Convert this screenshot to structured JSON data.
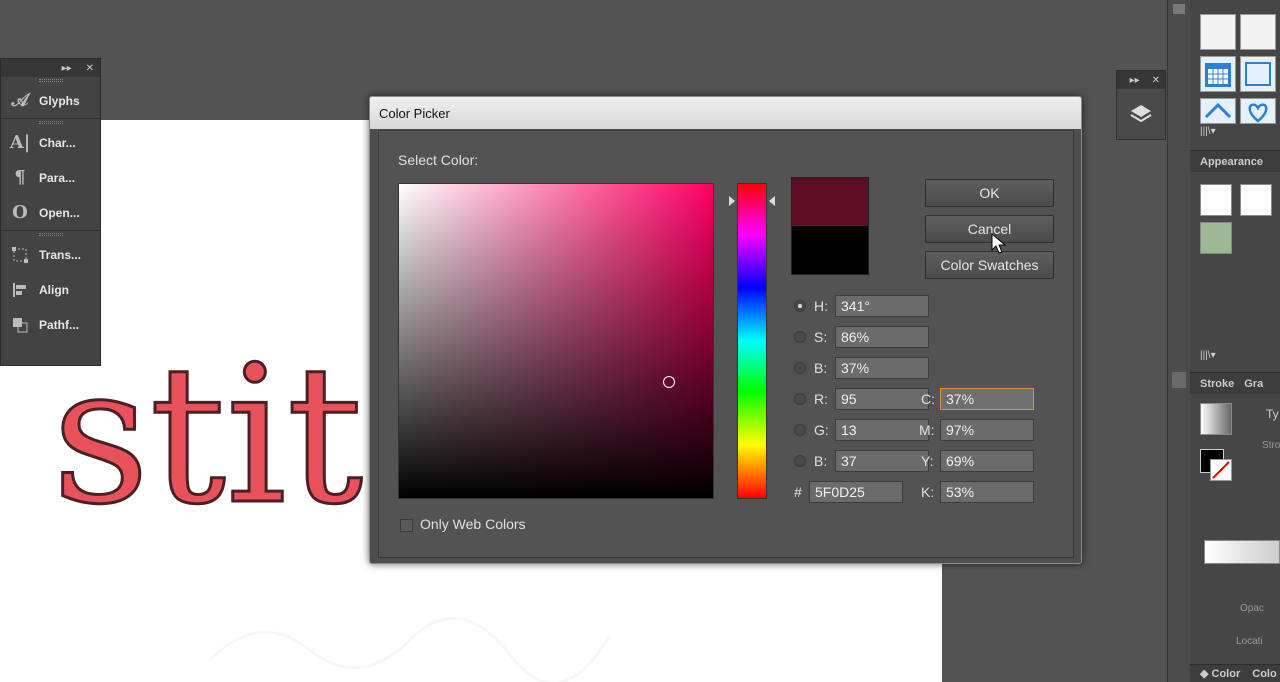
{
  "left_panel": {
    "items": [
      {
        "label": "Glyphs",
        "icon": "glyphs-icon"
      },
      {
        "label": "Char...",
        "icon": "character-icon"
      },
      {
        "label": "Para...",
        "icon": "paragraph-icon"
      },
      {
        "label": "Open...",
        "icon": "opentype-icon"
      },
      {
        "label": "Trans...",
        "icon": "transform-icon"
      },
      {
        "label": "Align",
        "icon": "align-icon"
      },
      {
        "label": "Pathf...",
        "icon": "pathfinder-icon"
      }
    ]
  },
  "artboard": {
    "text": "stitc",
    "text_color": "#e8525b"
  },
  "right_panel": {
    "appearance_title": "Appearance",
    "stroke_tab": "Stroke",
    "gradient_tab_partial": "Gra",
    "type_label_partial": "Ty",
    "stroke_label_partial": "Stro",
    "opacity_label_partial": "Opac",
    "location_label_partial": "Locati",
    "color_tab": "Color",
    "color_tab2_partial": "Colo"
  },
  "dialog": {
    "title": "Color Picker",
    "select_label": "Select Color:",
    "new_color": "#5f0d25",
    "old_color": "#000000",
    "buttons": {
      "ok": "OK",
      "cancel": "Cancel",
      "swatches": "Color Swatches"
    },
    "hsb": {
      "h_label": "H:",
      "h_value": "341°",
      "s_label": "S:",
      "s_value": "86%",
      "b_label": "B:",
      "b_value": "37%"
    },
    "rgb": {
      "r_label": "R:",
      "r_value": "95",
      "g_label": "G:",
      "g_value": "13",
      "b_label": "B:",
      "b_value": "37"
    },
    "hex": {
      "label": "#",
      "value": "5F0D25"
    },
    "cmyk": {
      "c_label": "C:",
      "c_value": "37%",
      "m_label": "M:",
      "m_value": "97%",
      "y_label": "Y:",
      "y_value": "69%",
      "k_label": "K:",
      "k_value": "53%"
    },
    "web_colors_label": "Only Web Colors",
    "hue_color": "#ff0062",
    "selected_radio": "H"
  }
}
